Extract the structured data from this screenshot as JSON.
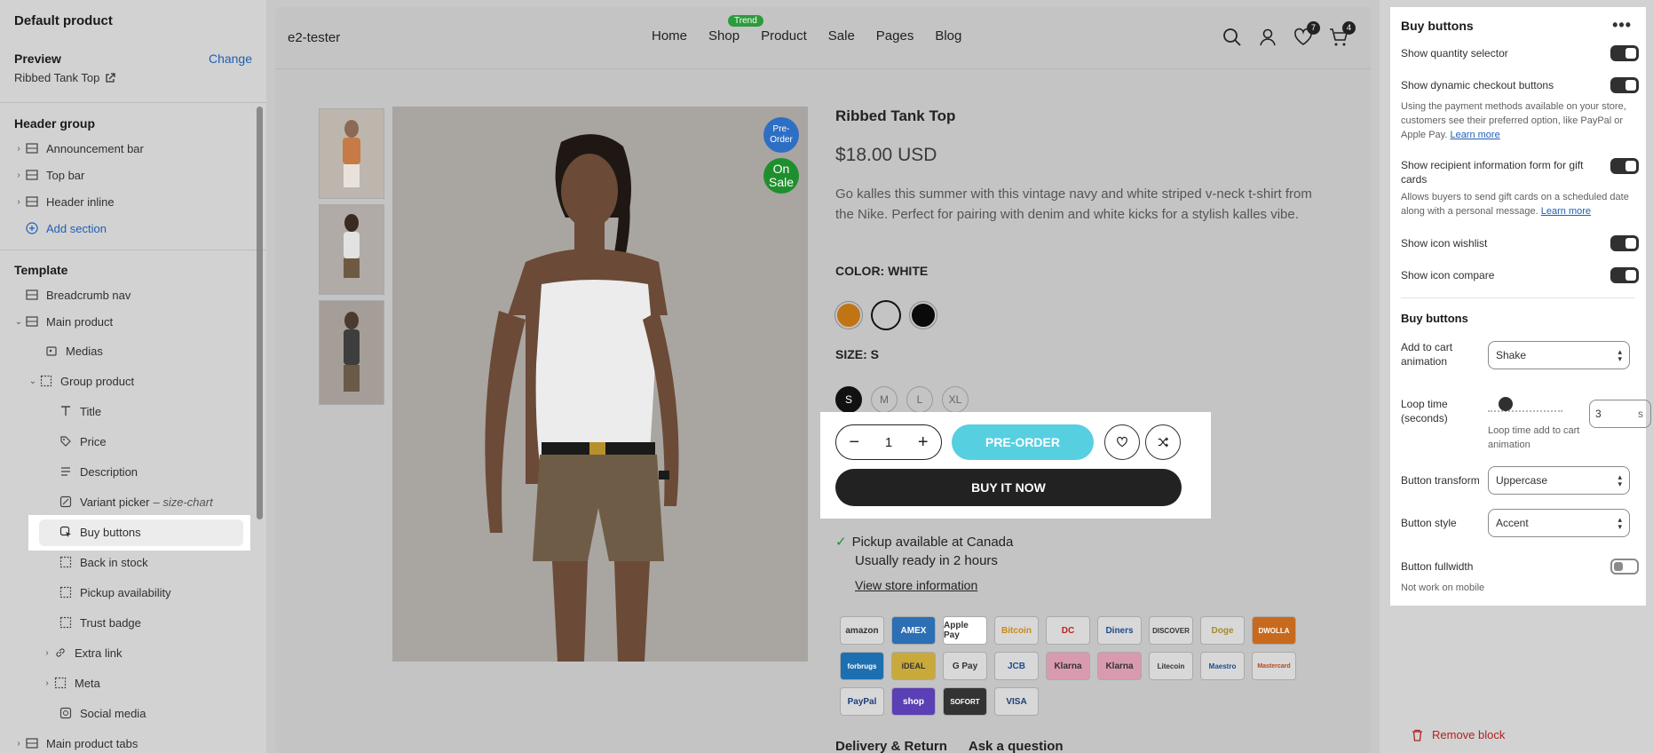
{
  "left": {
    "title": "Default product",
    "preview_label": "Preview",
    "change_label": "Change",
    "preview_value": "Ribbed Tank Top",
    "header_group_label": "Header group",
    "header_items": [
      "Announcement bar",
      "Top bar",
      "Header inline"
    ],
    "add_section": "Add section",
    "template_label": "Template",
    "template_items": {
      "breadcrumb": "Breadcrumb nav",
      "main_product": "Main product",
      "medias": "Medias",
      "group_product": "Group product",
      "title": "Title",
      "price": "Price",
      "description": "Description",
      "variant_picker": "Variant picker",
      "variant_picker_sub": "– size-chart",
      "buy_buttons": "Buy buttons",
      "back_in_stock": "Back in stock",
      "pickup": "Pickup availability",
      "trust_badge": "Trust badge",
      "extra_link": "Extra link",
      "meta": "Meta",
      "social_media": "Social media",
      "main_product_tabs": "Main product tabs"
    }
  },
  "store": {
    "brand": "e2-tester",
    "nav": [
      "Home",
      "Shop",
      "Product",
      "Sale",
      "Pages",
      "Blog"
    ],
    "trend_badge": "Trend",
    "wishlist_count": "7",
    "cart_count": "4",
    "badge_pre": "Pre-Order",
    "badge_sale": "On Sale",
    "product_title": "Ribbed Tank Top",
    "price": "$18.00 USD",
    "description": "Go kalles this summer with this vintage navy and white striped v-neck t-shirt from the Nike. Perfect for pairing with denim and white kicks for a stylish kalles vibe.",
    "color_label": "COLOR: WHITE",
    "colors": [
      "#c07414",
      "#c4c4c4",
      "#0a0a0a"
    ],
    "size_label": "SIZE: S",
    "sizes": [
      "S",
      "M",
      "L",
      "XL"
    ],
    "qty": "1",
    "preorder_label": "PRE-ORDER",
    "buy_now_label": "BUY IT NOW",
    "pickup_line1": "Pickup available at Canada",
    "pickup_line2": "Usually ready in 2 hours",
    "view_store": "View store information",
    "payments": [
      "amazon",
      "AMEX",
      "Apple Pay",
      "Bitcoin",
      "DC",
      "Diners",
      "DISCOVER",
      "Doge",
      "DWOLLA",
      "forbrugs",
      "iDEAL",
      "G Pay",
      "JCB",
      "Klarna",
      "Klarna",
      "Litecoin",
      "Maestro",
      "Mastercard",
      "PayPal",
      "shop",
      "SOFORT",
      "VISA"
    ],
    "tabs": [
      "Delivery & Return",
      "Ask a question"
    ]
  },
  "settings": {
    "title": "Buy buttons",
    "show_qty": "Show quantity selector",
    "show_dynamic": "Show dynamic checkout buttons",
    "dynamic_help": "Using the payment methods available on your store, customers see their preferred option, like PayPal or Apple Pay.",
    "learn_more": "Learn more",
    "show_recipient": "Show recipient information form for gift cards",
    "recipient_help": "Allows buyers to send gift cards on a scheduled date along with a personal message.",
    "show_wishlist": "Show icon wishlist",
    "show_compare": "Show icon compare",
    "subheading": "Buy buttons",
    "anim_label": "Add to cart animation",
    "anim_value": "Shake",
    "loop_label": "Loop time (seconds)",
    "loop_value": "3",
    "loop_unit": "s",
    "loop_help": "Loop time add to cart animation",
    "transform_label": "Button transform",
    "transform_value": "Uppercase",
    "style_label": "Button style",
    "style_value": "Accent",
    "fullwidth_label": "Button fullwidth",
    "fullwidth_help": "Not work on mobile",
    "remove_label": "Remove block"
  }
}
